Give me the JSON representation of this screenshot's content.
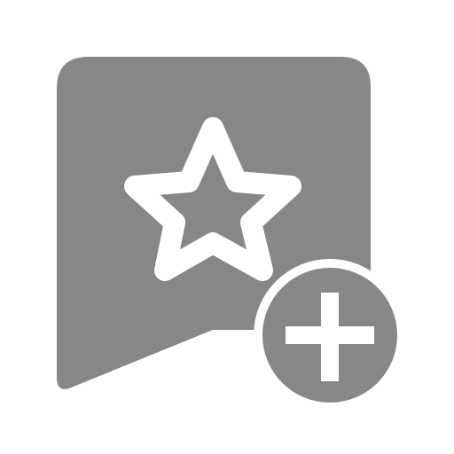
{
  "icon": {
    "name": "add-to-favorites-bookmark",
    "parts": [
      "bookmark-icon",
      "star-icon",
      "plus-badge-icon"
    ],
    "colors": {
      "background": "#ffffff",
      "glyph": "#878787",
      "outline": "#ffffff"
    }
  }
}
